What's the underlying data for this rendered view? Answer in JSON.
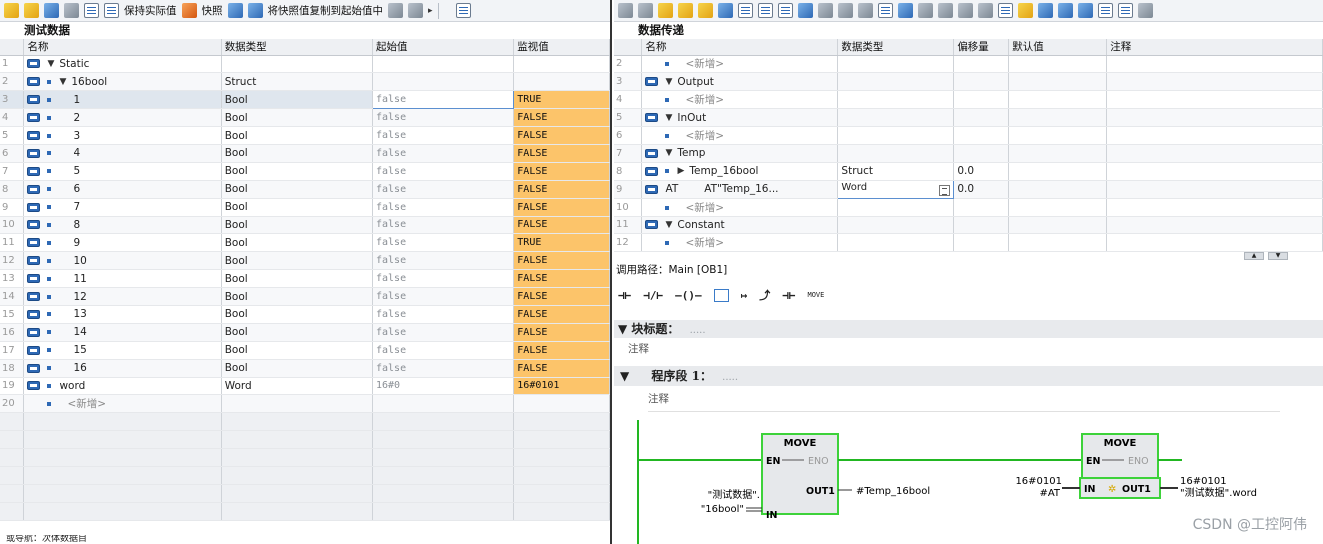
{
  "left": {
    "toolbar": {
      "keep_actual": "保持实际值",
      "snapshot": "快照",
      "copy_snapshot": "将快照值复制到起始值中"
    },
    "title": "测试数据",
    "headers": [
      "名称",
      "数据类型",
      "起始值",
      "监视值"
    ],
    "rows": [
      {
        "n": "1",
        "name": "Static",
        "type": "",
        "start": "",
        "mon": "",
        "level": 0,
        "expand": "▼",
        "icon": true,
        "dot": false
      },
      {
        "n": "2",
        "name": "16bool",
        "type": "Struct",
        "start": "",
        "mon": "",
        "level": 1,
        "expand": "▼",
        "icon": true,
        "dot": true
      },
      {
        "n": "3",
        "name": "1",
        "type": "Bool",
        "start": "false",
        "mon": "TRUE",
        "level": 2,
        "icon": true,
        "dot": true,
        "edit": true
      },
      {
        "n": "4",
        "name": "2",
        "type": "Bool",
        "start": "false",
        "mon": "FALSE",
        "level": 2,
        "icon": true,
        "dot": true
      },
      {
        "n": "5",
        "name": "3",
        "type": "Bool",
        "start": "false",
        "mon": "FALSE",
        "level": 2,
        "icon": true,
        "dot": true
      },
      {
        "n": "6",
        "name": "4",
        "type": "Bool",
        "start": "false",
        "mon": "FALSE",
        "level": 2,
        "icon": true,
        "dot": true
      },
      {
        "n": "7",
        "name": "5",
        "type": "Bool",
        "start": "false",
        "mon": "FALSE",
        "level": 2,
        "icon": true,
        "dot": true
      },
      {
        "n": "8",
        "name": "6",
        "type": "Bool",
        "start": "false",
        "mon": "FALSE",
        "level": 2,
        "icon": true,
        "dot": true
      },
      {
        "n": "9",
        "name": "7",
        "type": "Bool",
        "start": "false",
        "mon": "FALSE",
        "level": 2,
        "icon": true,
        "dot": true
      },
      {
        "n": "10",
        "name": "8",
        "type": "Bool",
        "start": "false",
        "mon": "FALSE",
        "level": 2,
        "icon": true,
        "dot": true
      },
      {
        "n": "11",
        "name": "9",
        "type": "Bool",
        "start": "false",
        "mon": "TRUE",
        "level": 2,
        "icon": true,
        "dot": true
      },
      {
        "n": "12",
        "name": "10",
        "type": "Bool",
        "start": "false",
        "mon": "FALSE",
        "level": 2,
        "icon": true,
        "dot": true
      },
      {
        "n": "13",
        "name": "11",
        "type": "Bool",
        "start": "false",
        "mon": "FALSE",
        "level": 2,
        "icon": true,
        "dot": true
      },
      {
        "n": "14",
        "name": "12",
        "type": "Bool",
        "start": "false",
        "mon": "FALSE",
        "level": 2,
        "icon": true,
        "dot": true
      },
      {
        "n": "15",
        "name": "13",
        "type": "Bool",
        "start": "false",
        "mon": "FALSE",
        "level": 2,
        "icon": true,
        "dot": true
      },
      {
        "n": "16",
        "name": "14",
        "type": "Bool",
        "start": "false",
        "mon": "FALSE",
        "level": 2,
        "icon": true,
        "dot": true
      },
      {
        "n": "17",
        "name": "15",
        "type": "Bool",
        "start": "false",
        "mon": "FALSE",
        "level": 2,
        "icon": true,
        "dot": true
      },
      {
        "n": "18",
        "name": "16",
        "type": "Bool",
        "start": "false",
        "mon": "FALSE",
        "level": 2,
        "icon": true,
        "dot": true
      },
      {
        "n": "19",
        "name": "word",
        "type": "Word",
        "start": "16#0",
        "mon": "16#0101",
        "level": 1,
        "icon": true,
        "dot": true
      },
      {
        "n": "20",
        "name": "<新增>",
        "type": "",
        "start": "",
        "mon": "",
        "level": 1,
        "icon": false,
        "dot": true,
        "placeholder": true
      }
    ],
    "status": "或导航：次体数据目"
  },
  "right": {
    "title": "数据传递",
    "headers": [
      "名称",
      "数据类型",
      "偏移量",
      "默认值",
      "注释"
    ],
    "rows": [
      {
        "n": "2",
        "name": "<新增>",
        "type": "",
        "offset": "",
        "level": 1,
        "icon": false,
        "dot": true,
        "placeholder": true
      },
      {
        "n": "3",
        "name": "Output",
        "type": "",
        "offset": "",
        "level": 0,
        "expand": "▼",
        "icon": true,
        "dot": false
      },
      {
        "n": "4",
        "name": "<新增>",
        "type": "",
        "offset": "",
        "level": 1,
        "icon": false,
        "dot": true,
        "placeholder": true
      },
      {
        "n": "5",
        "name": "InOut",
        "type": "",
        "offset": "",
        "level": 0,
        "expand": "▼",
        "icon": true,
        "dot": false
      },
      {
        "n": "6",
        "name": "<新增>",
        "type": "",
        "offset": "",
        "level": 1,
        "icon": false,
        "dot": true,
        "placeholder": true
      },
      {
        "n": "7",
        "name": "Temp",
        "type": "",
        "offset": "",
        "level": 0,
        "expand": "▼",
        "icon": true,
        "dot": false
      },
      {
        "n": "8",
        "name": "Temp_16bool",
        "type": "Struct",
        "offset": "0.0",
        "level": 1,
        "expand": "▶",
        "icon": true,
        "dot": true
      },
      {
        "n": "9",
        "name": "AT",
        "at": "AT\"Temp_16...",
        "type": "Word",
        "offset": "0.0",
        "level": 1,
        "icon": true,
        "dot": false,
        "edit": true
      },
      {
        "n": "10",
        "name": "<新增>",
        "type": "",
        "offset": "",
        "level": 1,
        "icon": false,
        "dot": true,
        "placeholder": true
      },
      {
        "n": "11",
        "name": "Constant",
        "type": "",
        "offset": "",
        "level": 0,
        "expand": "▼",
        "icon": true,
        "dot": false
      },
      {
        "n": "12",
        "name": "<新增>",
        "type": "",
        "offset": "",
        "level": 1,
        "icon": false,
        "dot": true,
        "placeholder": true
      }
    ],
    "call_path": "调用路径：Main [OB1]",
    "ld_toolbar": {
      "move": "MOVE"
    },
    "block_title": "块标题：",
    "block_comment": "注释",
    "network_title": "程序段 1：",
    "network_comment": "注释",
    "move1": {
      "title": "MOVE",
      "en": "EN",
      "eno": "ENO",
      "out1": "OUT1",
      "in": "IN",
      "in_operand_1": "\"测试数据\".",
      "in_operand_2": "\"16bool\"",
      "out_operand": "#Temp_16bool"
    },
    "move2": {
      "title": "MOVE",
      "en": "EN",
      "eno": "ENO",
      "out1": "OUT1",
      "in": "IN",
      "in_value": "16#0101",
      "in_operand": "#AT",
      "out_value": "16#0101",
      "out_operand": "\"测试数据\".word"
    }
  },
  "watermark": "CSDN @工控阿伟",
  "colors": {
    "monitor": "#fcc46a",
    "box_green": "#3dd23a",
    "power_rail": "#22b722"
  }
}
